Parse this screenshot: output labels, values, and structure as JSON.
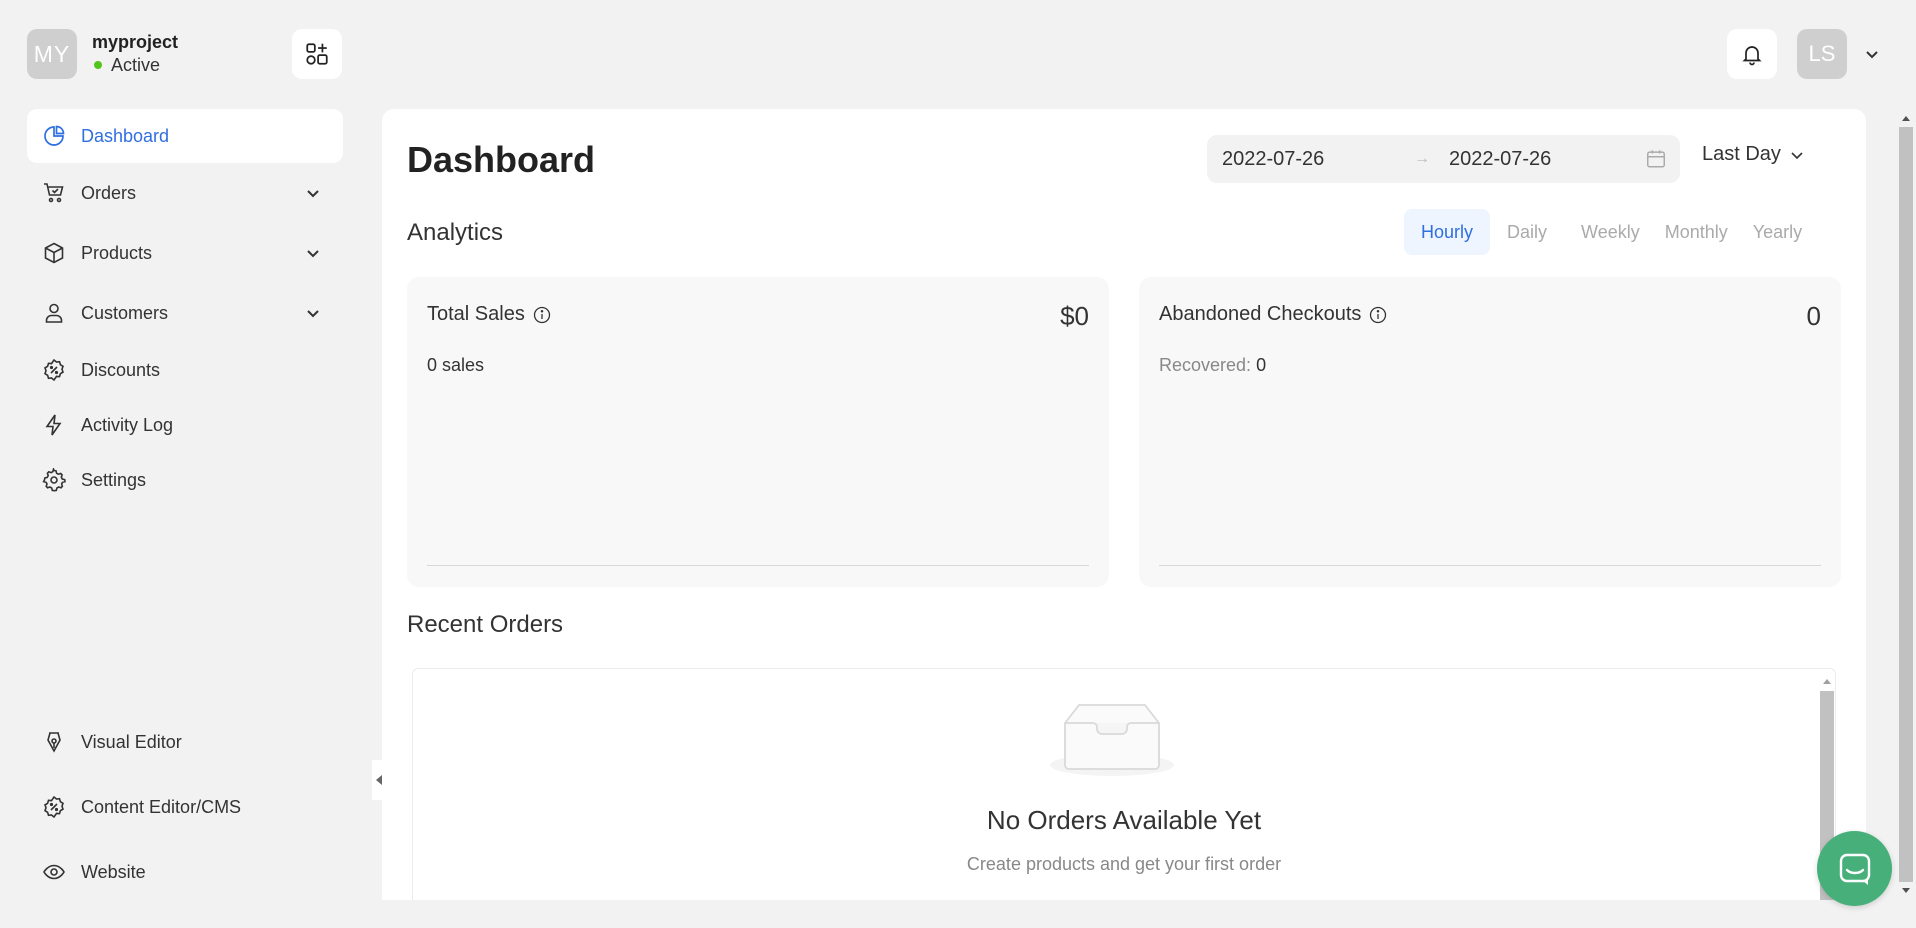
{
  "project": {
    "initials": "MY",
    "name": "myproject",
    "status": "Active",
    "status_color": "#52c41a"
  },
  "user": {
    "initials": "LS"
  },
  "sidebar": {
    "items": [
      {
        "label": "Dashboard",
        "icon": "pie-chart-icon",
        "active": true
      },
      {
        "label": "Orders",
        "icon": "cart-icon",
        "expandable": true
      },
      {
        "label": "Products",
        "icon": "box-icon",
        "expandable": true
      },
      {
        "label": "Customers",
        "icon": "user-icon",
        "expandable": true
      },
      {
        "label": "Discounts",
        "icon": "discount-icon"
      },
      {
        "label": "Activity Log",
        "icon": "lightning-icon"
      },
      {
        "label": "Settings",
        "icon": "gear-icon"
      }
    ],
    "bottom_items": [
      {
        "label": "Visual Editor",
        "icon": "pen-nib-icon"
      },
      {
        "label": "Content Editor/CMS",
        "icon": "discount-icon"
      },
      {
        "label": "Website",
        "icon": "eye-icon"
      }
    ]
  },
  "main": {
    "title": "Dashboard",
    "date_range": {
      "start": "2022-07-26",
      "end": "2022-07-26",
      "separator": "→"
    },
    "period": "Last Day",
    "analytics": {
      "title": "Analytics",
      "tabs": [
        {
          "label": "Hourly",
          "active": true
        },
        {
          "label": "Daily"
        },
        {
          "label": "Weekly"
        },
        {
          "label": "Monthly"
        },
        {
          "label": "Yearly"
        }
      ]
    },
    "cards": {
      "total_sales": {
        "title": "Total Sales",
        "value": "$0",
        "sub": "0 sales"
      },
      "abandoned": {
        "title": "Abandoned Checkouts",
        "value": "0",
        "sub_label": "Recovered:",
        "sub_value": "0"
      }
    },
    "recent_orders": {
      "title": "Recent Orders",
      "empty_title": "No Orders Available Yet",
      "empty_sub": "Create products and get your first order"
    }
  },
  "colors": {
    "accent": "#2f6fe0",
    "chat": "#47b07a",
    "background": "#f2f2f2"
  }
}
